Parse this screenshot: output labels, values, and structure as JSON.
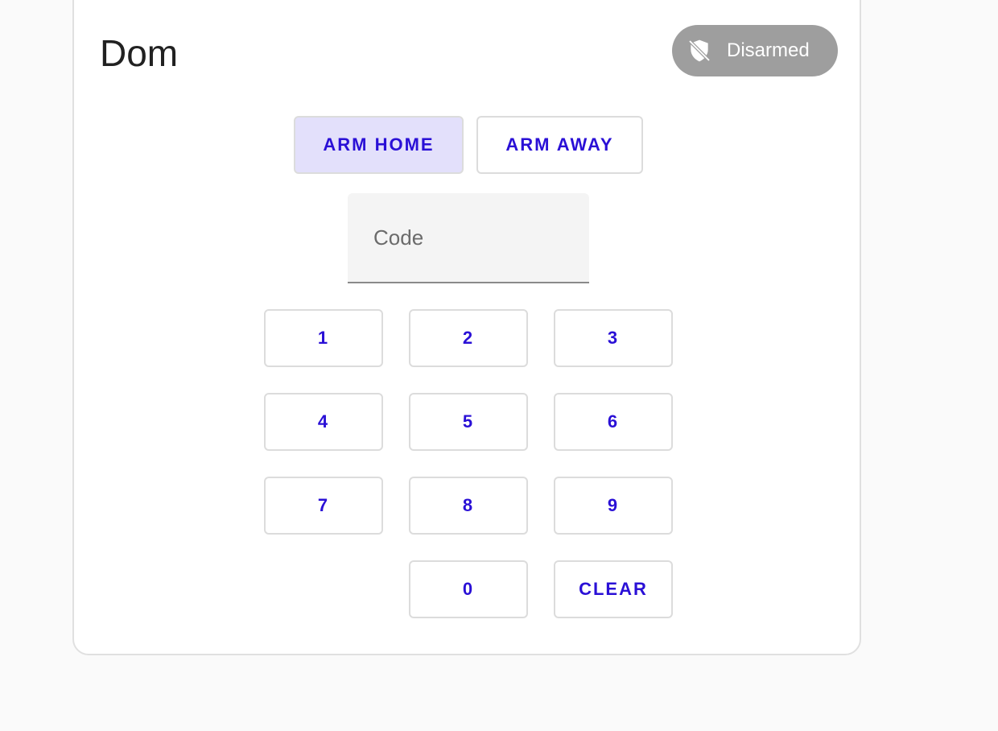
{
  "card": {
    "title": "Dom",
    "status": {
      "label": "Disarmed",
      "icon": "shield-off-icon",
      "color": "#9e9e9e"
    }
  },
  "modes": [
    {
      "label": "ARM HOME",
      "selected": true
    },
    {
      "label": "ARM AWAY",
      "selected": false
    }
  ],
  "code": {
    "placeholder": "Code",
    "value": ""
  },
  "keypad": {
    "k1": "1",
    "k2": "2",
    "k3": "3",
    "k4": "4",
    "k5": "5",
    "k6": "6",
    "k7": "7",
    "k8": "8",
    "k9": "9",
    "k0": "0",
    "clear": "CLEAR"
  },
  "colors": {
    "accent": "#2a10d6",
    "selected_bg": "#e3e0fb"
  }
}
